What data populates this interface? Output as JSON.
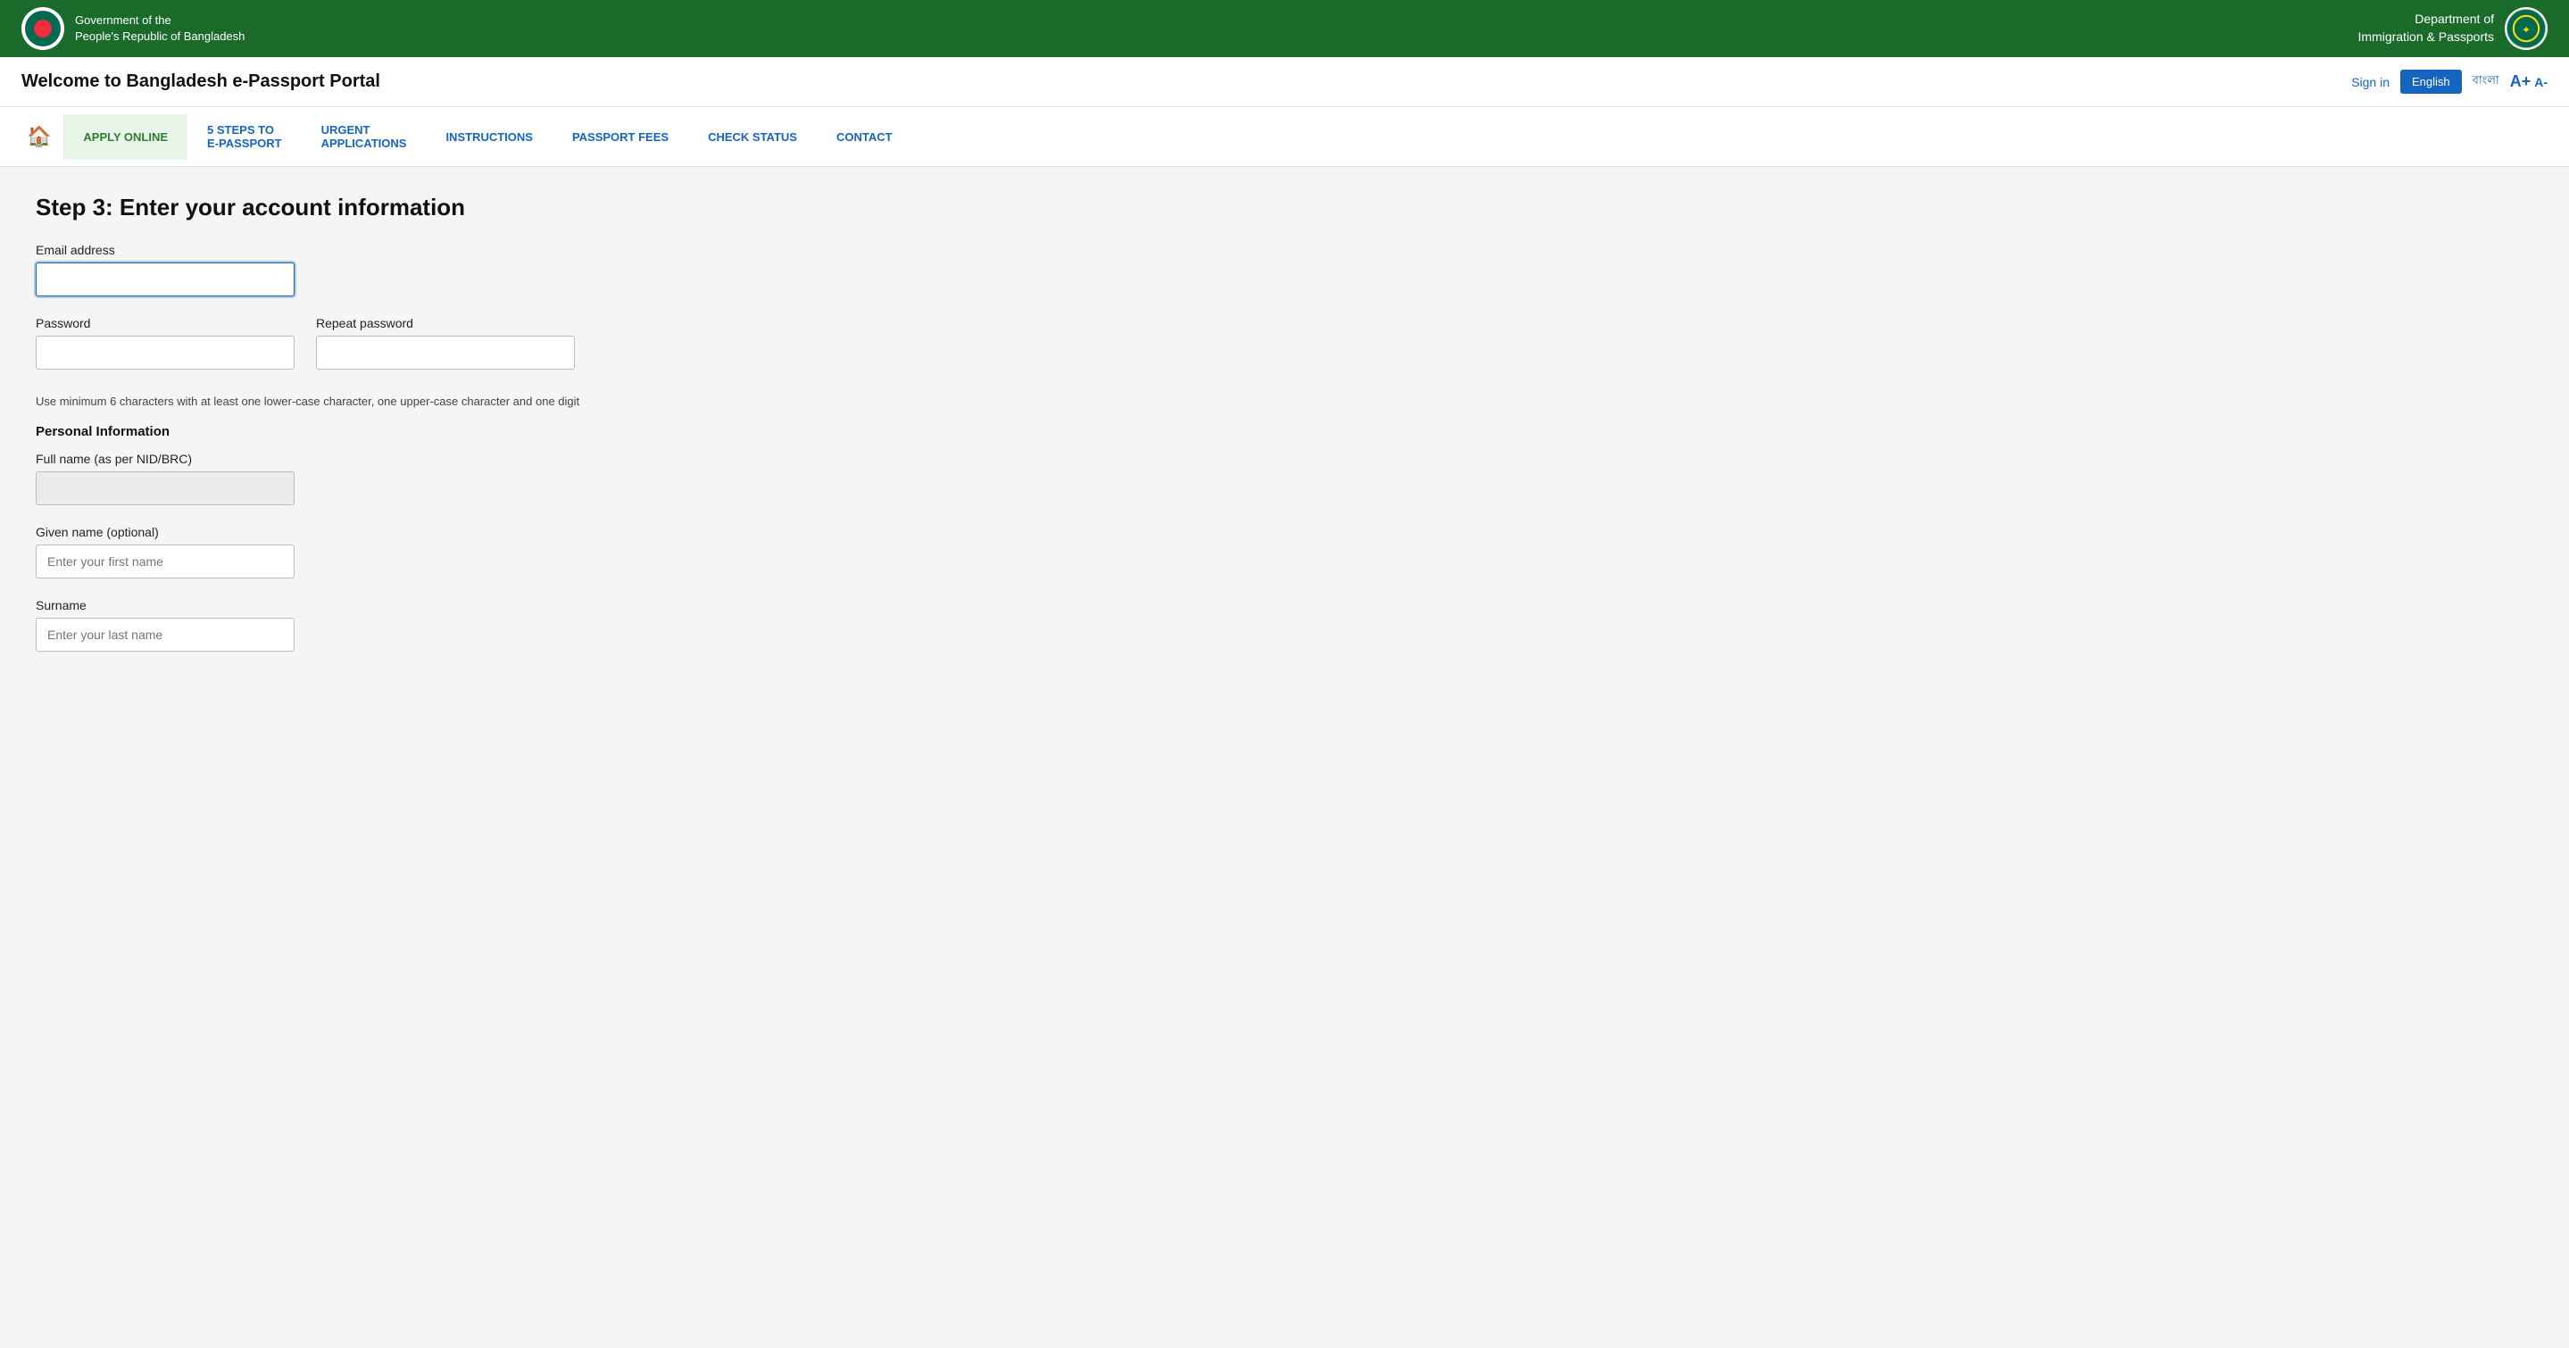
{
  "top_header": {
    "gov_title_line1": "Government of the",
    "gov_title_line2": "People's Republic of Bangladesh",
    "dept_title_line1": "Department of",
    "dept_title_line2": "Immigration & Passports"
  },
  "second_header": {
    "portal_title": "Welcome to Bangladesh e-Passport Portal",
    "sign_in": "Sign in",
    "lang_english": "English",
    "lang_bangla": "বাংলা",
    "font_large": "A+",
    "font_small": "A-"
  },
  "nav": {
    "home_icon": "🏠",
    "items": [
      {
        "label": "APPLY ONLINE",
        "active": true
      },
      {
        "label": "5 STEPS TO e-PASSPORT",
        "active": false
      },
      {
        "label": "URGENT APPLICATIONS",
        "active": false
      },
      {
        "label": "INSTRUCTIONS",
        "active": false
      },
      {
        "label": "PASSPORT FEES",
        "active": false
      },
      {
        "label": "CHECK STATUS",
        "active": false
      },
      {
        "label": "CONTACT",
        "active": false
      }
    ]
  },
  "form": {
    "step_title": "Step 3: Enter your account information",
    "email_label": "Email address",
    "email_placeholder": "",
    "password_label": "Password",
    "password_placeholder": "",
    "repeat_password_label": "Repeat password",
    "repeat_password_placeholder": "",
    "password_hint": "Use minimum 6 characters with at least one lower-case character, one upper-case character and one digit",
    "personal_info_label": "Personal Information",
    "full_name_label": "Full name (as per NID/BRC)",
    "full_name_placeholder": "",
    "given_name_label": "Given name (optional)",
    "given_name_placeholder": "Enter your first name",
    "surname_label": "Surname",
    "surname_placeholder": "Enter your last name"
  }
}
